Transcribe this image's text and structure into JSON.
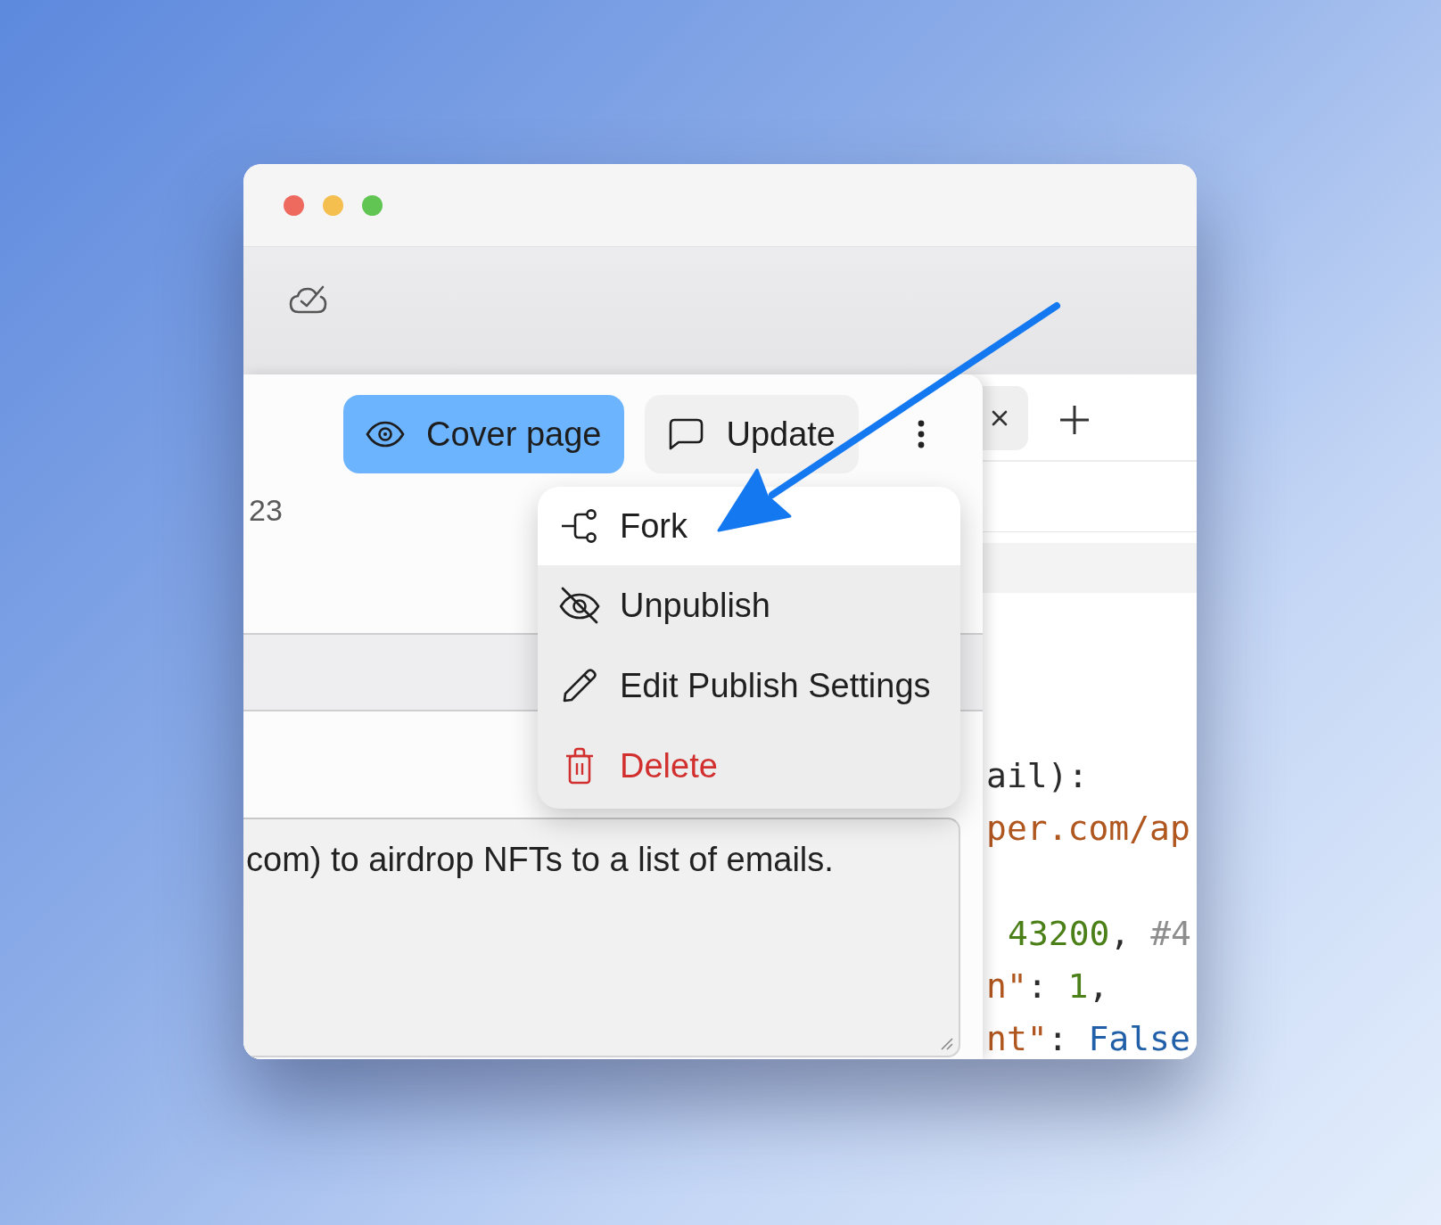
{
  "panel": {
    "buttons": [
      {
        "label": "Cover page",
        "active": true
      },
      {
        "label": "Update",
        "active": false
      }
    ],
    "fragment": "23",
    "description": "com) to airdrop NFTs to a list of emails."
  },
  "menu": {
    "items": [
      {
        "label": "Fork",
        "highlighted": true,
        "destructive": false
      },
      {
        "label": "Unpublish",
        "highlighted": false,
        "destructive": false
      },
      {
        "label": "Edit Publish Settings",
        "highlighted": false,
        "destructive": false
      },
      {
        "label": "Delete",
        "highlighted": false,
        "destructive": true
      }
    ]
  },
  "editor": {
    "code_lines": [
      {
        "kind": "code",
        "indent": false,
        "tokens": [
          {
            "kind": "plain",
            "text": "ail):"
          }
        ]
      },
      {
        "kind": "code",
        "indent": false,
        "tokens": [
          {
            "kind": "string",
            "text": "per.com/ap"
          }
        ]
      },
      {
        "kind": "blank"
      },
      {
        "kind": "code",
        "indent": true,
        "tokens": [
          {
            "kind": "number",
            "text": "43200"
          },
          {
            "kind": "plain",
            "text": ", "
          },
          {
            "kind": "comment",
            "text": "#4"
          }
        ]
      },
      {
        "kind": "code",
        "indent": false,
        "tokens": [
          {
            "kind": "string",
            "text": "n\""
          },
          {
            "kind": "plain",
            "text": ": "
          },
          {
            "kind": "number",
            "text": "1"
          },
          {
            "kind": "plain",
            "text": ","
          }
        ]
      },
      {
        "kind": "code",
        "indent": false,
        "tokens": [
          {
            "kind": "string",
            "text": "nt\""
          },
          {
            "kind": "plain",
            "text": ": "
          },
          {
            "kind": "keyword",
            "text": "False"
          }
        ]
      }
    ]
  }
}
